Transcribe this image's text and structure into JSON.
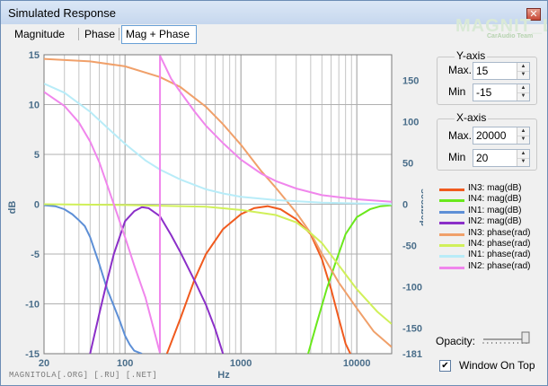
{
  "window": {
    "title": "Simulated Response",
    "close_glyph": "✕",
    "logo": "MAGNIT_LA",
    "logo_sub": "CarAudio Team"
  },
  "tabs": [
    {
      "label": "Magnitude",
      "selected": false
    },
    {
      "label": "Phase",
      "selected": false
    },
    {
      "label": "Mag + Phase",
      "selected": true
    }
  ],
  "yaxis_panel": {
    "title": "Y-axis",
    "max_label": "Max.",
    "max_value": "15",
    "min_label": "Min",
    "min_value": "-15"
  },
  "xaxis_panel": {
    "title": "X-axis",
    "max_label": "Max.",
    "max_value": "20000",
    "min_label": "Min",
    "min_value": "20"
  },
  "opacity": {
    "label": "Opacity:",
    "value": 1.0
  },
  "window_on_top": {
    "label": "Window On Top",
    "checked": true
  },
  "footer": "MAGNITOLA[.ORG] [.RU] [.NET]",
  "colors": {
    "background": "#f0f0f0",
    "grid": "#b4b4b4",
    "axis_text": "#4a6e8a",
    "tab_border": "#68a0d6"
  },
  "icons": {
    "close": "close-icon",
    "spin_up": "chevron-up-icon",
    "spin_down": "chevron-down-icon",
    "check": "checkmark-icon"
  },
  "chart_data": {
    "type": "line",
    "title": "",
    "xlabel": "Hz",
    "ylabel": "dB",
    "y2label": "degrees",
    "xscale": "log",
    "xlim": [
      20,
      20000
    ],
    "ylim": [
      -15,
      15
    ],
    "y2lim": [
      -181,
      181
    ],
    "grid": true,
    "legend_position": "right",
    "x_ticks": [
      "20",
      "100",
      "1000",
      "10000"
    ],
    "y_ticks": [
      "15",
      "10",
      "5",
      "0",
      "-5",
      "-10",
      "-15"
    ],
    "y2_ticks": [
      "150",
      "100",
      "50",
      "0",
      "-50",
      "-100",
      "-150",
      "-181"
    ],
    "series": [
      {
        "name": "IN3: mag(dB)",
        "color": "#f05a1e",
        "axis": "left",
        "x": [
          230,
          300,
          400,
          500,
          700,
          1000,
          1300,
          1700,
          2200,
          3000,
          4000,
          5000,
          6000,
          7000,
          8000,
          8800
        ],
        "y": [
          -15,
          -11.5,
          -7.5,
          -5,
          -2.5,
          -1,
          -0.4,
          -0.2,
          -0.5,
          -1.5,
          -3,
          -5.5,
          -8.5,
          -11.5,
          -14,
          -15
        ]
      },
      {
        "name": "IN4: mag(dB)",
        "color": "#6ae81c",
        "axis": "left",
        "x": [
          3800,
          4500,
          5500,
          6500,
          8000,
          10000,
          13000,
          16000,
          20000
        ],
        "y": [
          -15,
          -12,
          -8.5,
          -6,
          -3,
          -1.3,
          -0.5,
          -0.2,
          -0.1
        ]
      },
      {
        "name": "IN1: mag(dB)",
        "color": "#5d8fd6",
        "axis": "left",
        "x": [
          20,
          25,
          30,
          35,
          40,
          45,
          50,
          60,
          70,
          80,
          90,
          100,
          110,
          120,
          140
        ],
        "y": [
          -0.1,
          -0.2,
          -0.5,
          -1,
          -1.6,
          -2.2,
          -3.3,
          -6,
          -8.5,
          -10.2,
          -11.7,
          -13.2,
          -14.1,
          -14.7,
          -15
        ]
      },
      {
        "name": "IN2: mag(dB)",
        "color": "#8b2fc8",
        "axis": "left",
        "x": [
          50,
          60,
          70,
          80,
          100,
          120,
          140,
          160,
          200,
          250,
          300,
          400,
          500,
          600,
          700
        ],
        "y": [
          -15,
          -11,
          -7.7,
          -5,
          -1.7,
          -0.7,
          -0.3,
          -0.4,
          -1.2,
          -3.1,
          -4.8,
          -7.7,
          -10.1,
          -12.5,
          -15
        ]
      },
      {
        "name": "IN3: phase(rad)",
        "color": "#f0a06a",
        "axis": "right",
        "x": [
          20,
          50,
          100,
          200,
          300,
          500,
          700,
          1000,
          1500,
          2000,
          3000,
          4000,
          5000,
          7000,
          10000,
          14000,
          20000
        ],
        "y": [
          176,
          173,
          167,
          154,
          142,
          118,
          97,
          72,
          40,
          20,
          -10,
          -35,
          -60,
          -95,
          -126,
          -154,
          -173
        ]
      },
      {
        "name": "IN4: phase(rad)",
        "color": "#d0f05a",
        "axis": "right",
        "x": [
          20,
          100,
          500,
          1000,
          2000,
          3000,
          4000,
          5000,
          7000,
          10000,
          15000,
          20000
        ],
        "y": [
          0,
          -1,
          -3,
          -7,
          -13,
          -22,
          -35,
          -47,
          -74,
          -103,
          -130,
          -145
        ]
      },
      {
        "name": "IN1: phase(rad)",
        "color": "#b8ecf8",
        "axis": "right",
        "x": [
          20,
          30,
          50,
          70,
          100,
          150,
          200,
          300,
          500,
          700,
          1000,
          2000,
          5000,
          10000,
          20000
        ],
        "y": [
          146,
          135,
          112,
          93,
          73,
          53,
          42,
          30,
          18,
          13,
          9,
          5,
          2,
          1,
          0
        ]
      },
      {
        "name": "IN2: phase(rad)",
        "color": "#f086ec",
        "axis": "right",
        "x": [
          20,
          30,
          40,
          50,
          60,
          80,
          100,
          120,
          150,
          200,
          200.5,
          250,
          300,
          400,
          500,
          700,
          1000,
          1500,
          2000,
          3000,
          5000,
          10000,
          20000
        ],
        "y": [
          136,
          119,
          99,
          76,
          51,
          0,
          -40,
          -74,
          -113,
          -180,
          180,
          152,
          136,
          112,
          95,
          74,
          54,
          37,
          28,
          19,
          11,
          6,
          3
        ]
      }
    ]
  }
}
